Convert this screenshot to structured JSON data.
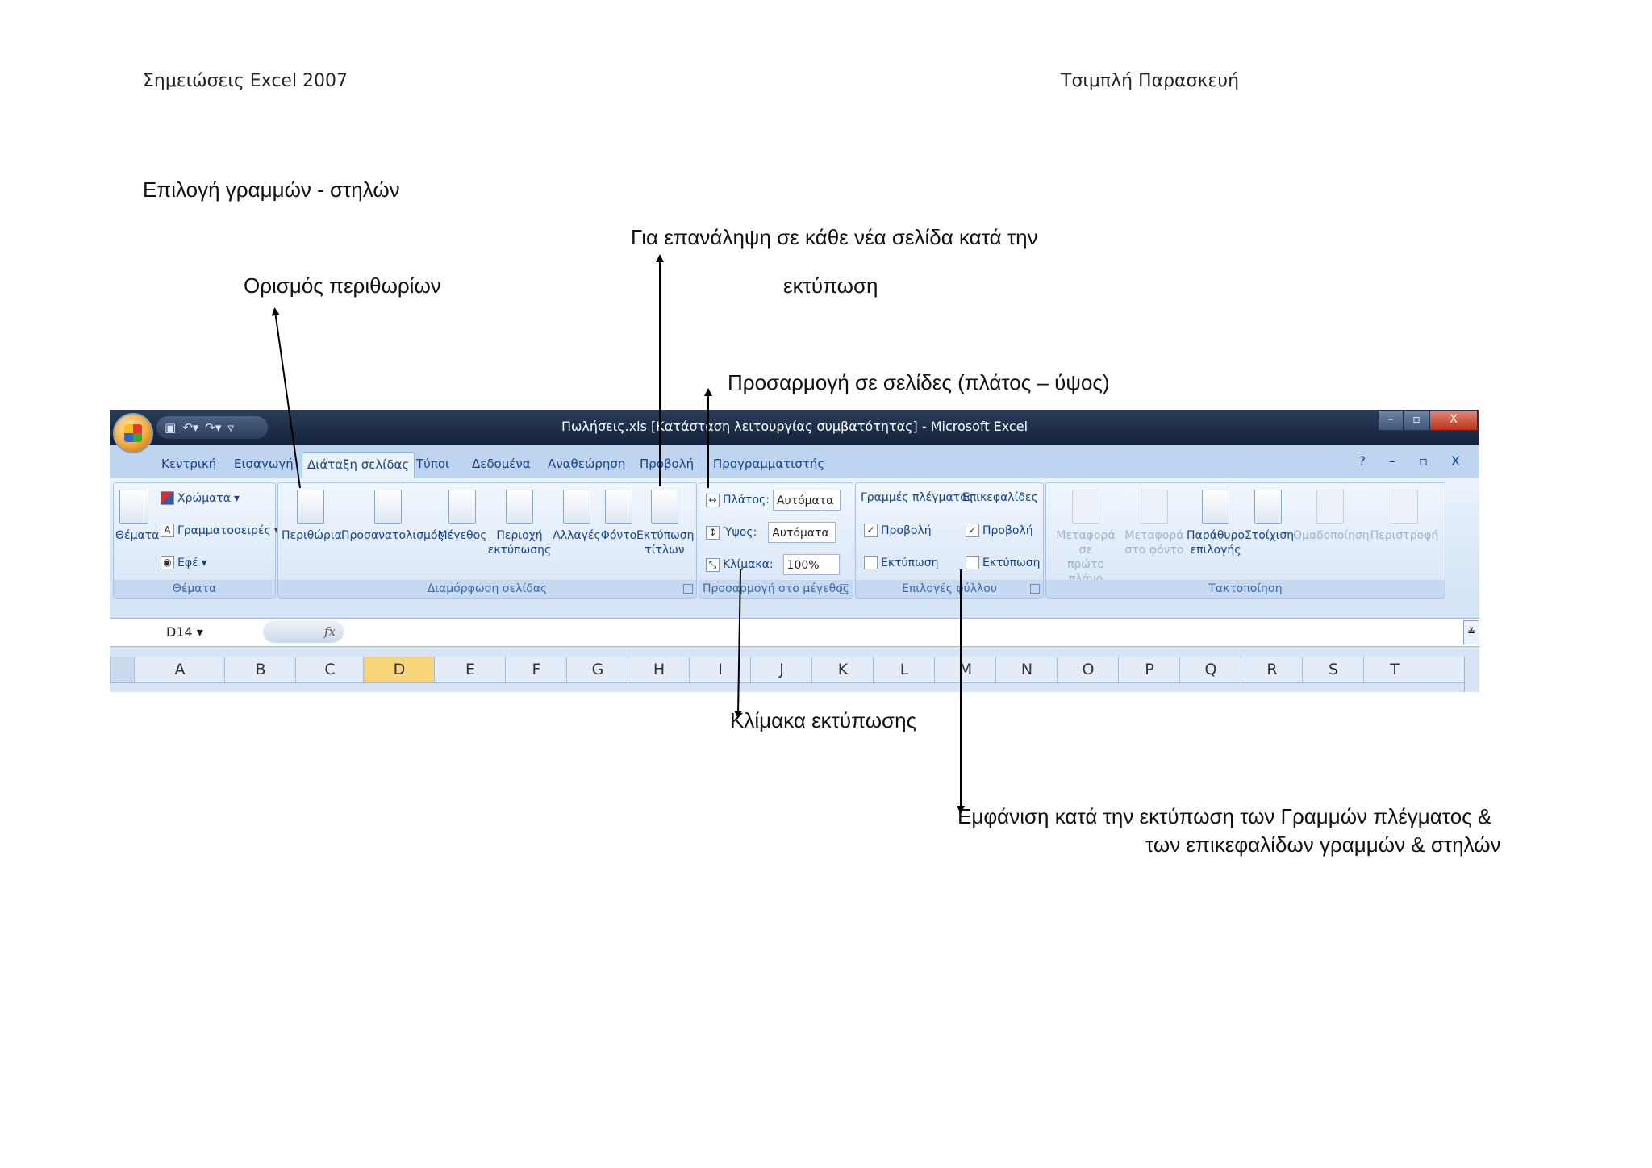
{
  "header": {
    "left": "Σημειώσεις Excel 2007",
    "right": "Τσιμπλή Παρασκευή"
  },
  "notes": {
    "select_rows_cols": "Επιλογή γραμμών - στηλών",
    "margins": "Ορισμός περιθωρίων",
    "repeat_line1": "Για επανάληψη σε κάθε νέα σελίδα κατά την",
    "repeat_line2": "εκτύπωση",
    "fit_pages": "Προσαρμογή σε σελίδες (πλάτος – ύψος)",
    "scale": "Κλίμακα εκτύπωσης",
    "gridlines_line1": "Εμφάνιση κατά την εκτύπωση των  Γραμμών πλέγματος &",
    "gridlines_line2": "των επικεφαλίδων γραμμών & στηλών"
  },
  "excel": {
    "title": "Πωλήσεις.xls  [Κατάσταση λειτουργίας συμβατότητας] - Microsoft Excel",
    "qat_icons": [
      "save-icon",
      "undo-icon",
      "redo-icon",
      "customize-icon"
    ],
    "window_controls": {
      "minimize": "–",
      "restore": "▫",
      "close": "X"
    },
    "help_controls": "? – ▫ X",
    "tabs": [
      "Κεντρική",
      "Εισαγωγή",
      "Διάταξη σελίδας",
      "Τύποι",
      "Δεδομένα",
      "Αναθεώρηση",
      "Προβολή",
      "Προγραμματιστής"
    ],
    "active_tab": "Διάταξη σελίδας",
    "groups": {
      "themes": {
        "label": "Θέματα",
        "themes_btn": "Θέματα",
        "colors": "Χρώματα",
        "fonts": "Γραμματοσειρές",
        "effects": "Εφέ"
      },
      "page_setup": {
        "label": "Διαμόρφωση σελίδας",
        "margins": "Περιθώρια",
        "orientation": "Προσανατολισμός",
        "size": "Μέγεθος",
        "print_area_1": "Περιοχή",
        "print_area_2": "εκτύπωσης",
        "breaks": "Αλλαγές",
        "background": "Φόντο",
        "print_titles_1": "Εκτύπωση",
        "print_titles_2": "τίτλων"
      },
      "scale_to_fit": {
        "label": "Προσαρμογή στο μέγεθος",
        "width_label": "Πλάτος:",
        "width_value": "Αυτόματα",
        "height_label": "Ύψος:",
        "height_value": "Αυτόματα",
        "scale_label": "Κλίμακα:",
        "scale_value": "100%"
      },
      "sheet_options": {
        "label": "Επιλογές φύλλου",
        "gridlines": "Γραμμές πλέγματος",
        "headings": "Επικεφαλίδες",
        "view": "Προβολή",
        "print": "Εκτύπωση",
        "gridlines_view_checked": true,
        "gridlines_print_checked": false,
        "headings_view_checked": true,
        "headings_print_checked": false
      },
      "arrange": {
        "label": "Τακτοποίηση",
        "bring_front_1": "Μεταφορά σε",
        "bring_front_2": "πρώτο πλάνο",
        "send_back_1": "Μεταφορά",
        "send_back_2": "στο φόντο",
        "selection_pane_1": "Παράθυρο",
        "selection_pane_2": "επιλογής",
        "align": "Στοίχιση",
        "group": "Ομαδοποίηση",
        "rotate": "Περιστροφή"
      }
    },
    "name_box": "D14",
    "fx_label": "fx",
    "columns": [
      "A",
      "B",
      "C",
      "D",
      "E",
      "F",
      "G",
      "H",
      "I",
      "J",
      "K",
      "L",
      "M",
      "N",
      "O",
      "P",
      "Q",
      "R",
      "S",
      "T"
    ],
    "selected_column": "D",
    "colors": {
      "titlebar": "#1f2f48",
      "ribbon": "#dbe7f6",
      "accent_text": "#15428b",
      "selected_col": "#f8d47a"
    }
  }
}
